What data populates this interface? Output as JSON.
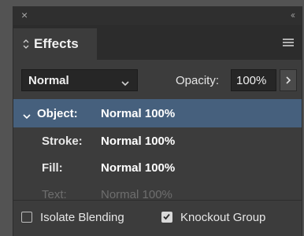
{
  "titlebar": {
    "close_icon": "×",
    "collapse_icon": "‹‹"
  },
  "panel": {
    "tab_label": "Effects",
    "menu_icon": "panel-menu-icon"
  },
  "blend": {
    "mode": "Normal"
  },
  "opacity": {
    "label": "Opacity:",
    "value": "100%"
  },
  "targets": [
    {
      "name": "Object:",
      "value": "Normal 100%",
      "selected": true
    },
    {
      "name": "Stroke:",
      "value": "Normal 100%"
    },
    {
      "name": "Fill:",
      "value": "Normal 100%"
    },
    {
      "name": "Text:",
      "value": "Normal 100%",
      "disabled": true
    }
  ],
  "footer": {
    "isolate_label": "Isolate Blending",
    "isolate_checked": false,
    "knockout_label": "Knockout Group",
    "knockout_checked": true
  },
  "colors": {
    "selection": "#46607d",
    "panel_bg": "#3c3c3c"
  }
}
